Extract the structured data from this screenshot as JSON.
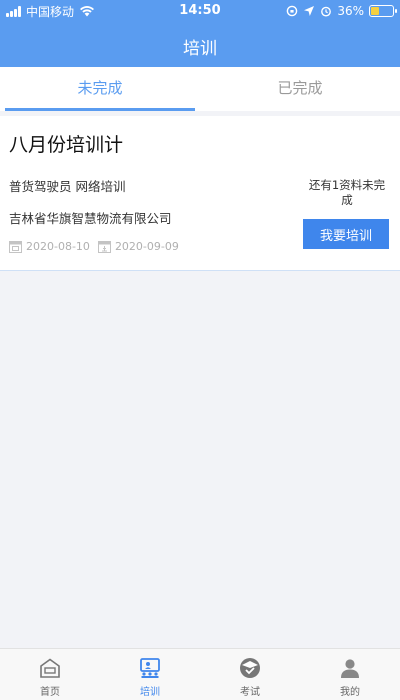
{
  "status_bar": {
    "carrier": "中国移动",
    "time": "14:50",
    "battery_text": "36%",
    "battery_level": 0.36,
    "battery_color": "#f5d042"
  },
  "header": {
    "title": "培训"
  },
  "tabs": [
    {
      "label": "未完成",
      "active": true
    },
    {
      "label": "已完成",
      "active": false
    }
  ],
  "card": {
    "title": "八月份培训计",
    "category": "普货驾驶员  网络培训",
    "company": "吉林省华旗智慧物流有限公司",
    "start_date": "2020-08-10",
    "end_date": "2020-09-09",
    "remaining_text": "还有1资料未完成",
    "action_label": "我要培训"
  },
  "bottom_nav": [
    {
      "label": "首页",
      "icon": "home-icon",
      "active": false
    },
    {
      "label": "培训",
      "icon": "training-icon",
      "active": true
    },
    {
      "label": "考试",
      "icon": "exam-icon",
      "active": false
    },
    {
      "label": "我的",
      "icon": "profile-icon",
      "active": false
    }
  ],
  "colors": {
    "primary": "#5a9cf0",
    "button": "#3f86ec",
    "background": "#f2f3f7"
  }
}
